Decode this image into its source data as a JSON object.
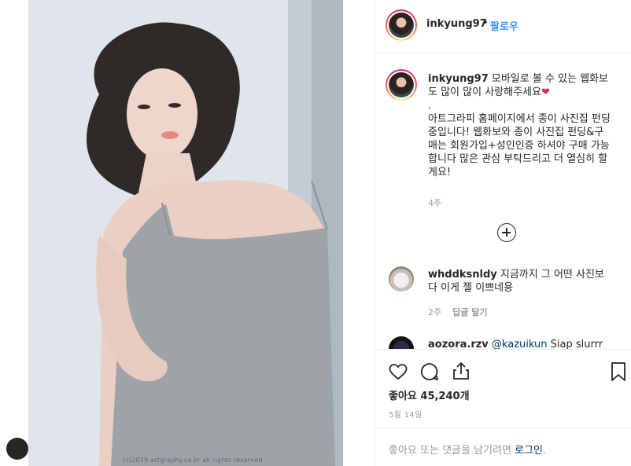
{
  "photo": {
    "watermark": "(c)2019 artgraphy.co.kr all rights reserved"
  },
  "header": {
    "username": "inkyung97",
    "separator": "•",
    "follow_label": "팔로우"
  },
  "caption": {
    "username": "inkyung97",
    "text": " 모바일로 볼 수 있는 웹화보도 많이 많이 사랑해주세요",
    "heart": "❤",
    "body": "\n.\n아트그라피 홈페이지에서 종이 사진집 펀딩중입니다! 웹화보와 종이 사진집 펀딩&구매는 회원가입+성인인증 하셔야 구매 가능합니다 많은 관심 부탁드리고 더 열심히 할게요!",
    "time": "4주"
  },
  "comments": [
    {
      "username": "whddksnldy",
      "text": " 지금까지 그 어떤 사진보다 이게 젤 이쁘네용",
      "time": "2주",
      "reply_label": "답글 달기"
    },
    {
      "username": "aozora.rzv",
      "mention": "@kazuikun",
      "text": " Siap slurrr"
    }
  ],
  "actions": {
    "likes_label": "좋아요 45,240개",
    "date": "5월 14일"
  },
  "add_comment": {
    "prompt": "좋아요 또는 댓글을 남기려면 ",
    "login_label": "로그인",
    "suffix": "."
  },
  "icons": {
    "like": "heart-icon",
    "comment": "comment-icon",
    "share": "share-icon",
    "save": "bookmark-icon",
    "load_more": "plus-circle-icon"
  }
}
